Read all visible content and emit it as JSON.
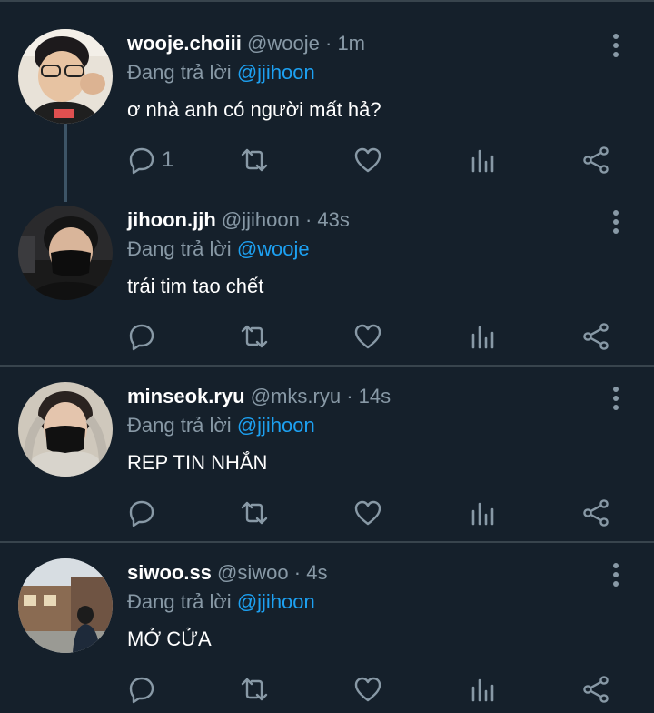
{
  "tweets": [
    {
      "name": "wooje.choiii",
      "handle": "@wooje",
      "time": "1m",
      "reply_prefix": "Đang trả lời",
      "reply_to": "@jjihoon",
      "text": "ơ nhà anh có người mất hả?",
      "reply_count": "1",
      "avatar": "avatar-wooje"
    },
    {
      "name": "jihoon.jjh",
      "handle": "@jjihoon",
      "time": "43s",
      "reply_prefix": "Đang trả lời",
      "reply_to": "@wooje",
      "text": "trái tim tao chết",
      "reply_count": "",
      "avatar": "avatar-jihoon"
    },
    {
      "name": "minseok.ryu",
      "handle": "@mks.ryu",
      "time": "14s",
      "reply_prefix": "Đang trả lời",
      "reply_to": "@jjihoon",
      "text": "REP TIN NHẮN",
      "reply_count": "",
      "avatar": "avatar-minseok"
    },
    {
      "name": "siwoo.ss",
      "handle": "@siwoo",
      "time": "4s",
      "reply_prefix": "Đang trả lời",
      "reply_to": "@jjihoon",
      "text": "MỞ CỬA",
      "reply_count": "",
      "avatar": "avatar-siwoo"
    }
  ],
  "separator": "·",
  "colors": {
    "background": "#15202b",
    "divider": "#38444d",
    "muted": "#8899a6",
    "accent": "#1da1f2",
    "text": "#ffffff"
  },
  "icons": [
    "reply-icon",
    "retweet-icon",
    "like-icon",
    "analytics-icon",
    "share-icon",
    "more-icon"
  ]
}
